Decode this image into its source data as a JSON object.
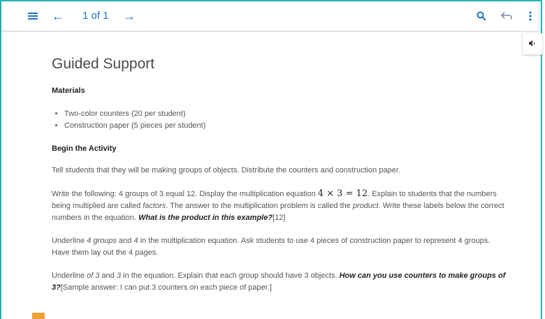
{
  "toolbar": {
    "page_counter": "1 of 1",
    "icons": [
      "list-menu-icon",
      "arrow-left-icon",
      "arrow-right-icon",
      "search-icon",
      "back-arrow-icon",
      "more-vertical-icon"
    ]
  },
  "audio": {
    "icon": "speaker-icon"
  },
  "content": {
    "title": "Guided Support",
    "materials_heading": "Materials",
    "materials": [
      "Two-color counters (20 per student)",
      "Construction paper (5 pieces per student)"
    ],
    "activity_heading": "Begin the Activity",
    "p1": "Tell students that they will be making groups of objects. Distribute the counters and construction paper.",
    "p2": {
      "a": "Write the following: 4 groups of 3 equal 12. Display the multiplication equation ",
      "math": "4 × 3 = 12",
      "b": ". Explain to students that the numbers being multiplied are called ",
      "factors": "factors",
      "c": ". The answer to the multiplication problem is called the ",
      "product": "product",
      "d": ". Write these labels below the correct numbers in the equation. ",
      "question": "What is the product in this example?",
      "answer": "[12]"
    },
    "p3": {
      "a": "Underline ",
      "groups": "4 groups",
      "b": " and ",
      "four": "4",
      "c": " in the multiplication equation. Ask students to use 4 pieces of construction paper to represent 4 groups. Have them lay out the 4 pages."
    },
    "p4": {
      "a": "Underline ",
      "of3": "of 3",
      "b": " and ",
      "three": "3",
      "c": " in the equation. Explain that each group should have 3 objects. ",
      "question": "How can you use counters to make groups of 3?",
      "answer": "[Sample answer: I can put 3 counters on each piece of paper.]"
    }
  },
  "colors": {
    "accent": "#1a73c8",
    "frame": "#1fb5b5",
    "marker": "#f0a030"
  }
}
